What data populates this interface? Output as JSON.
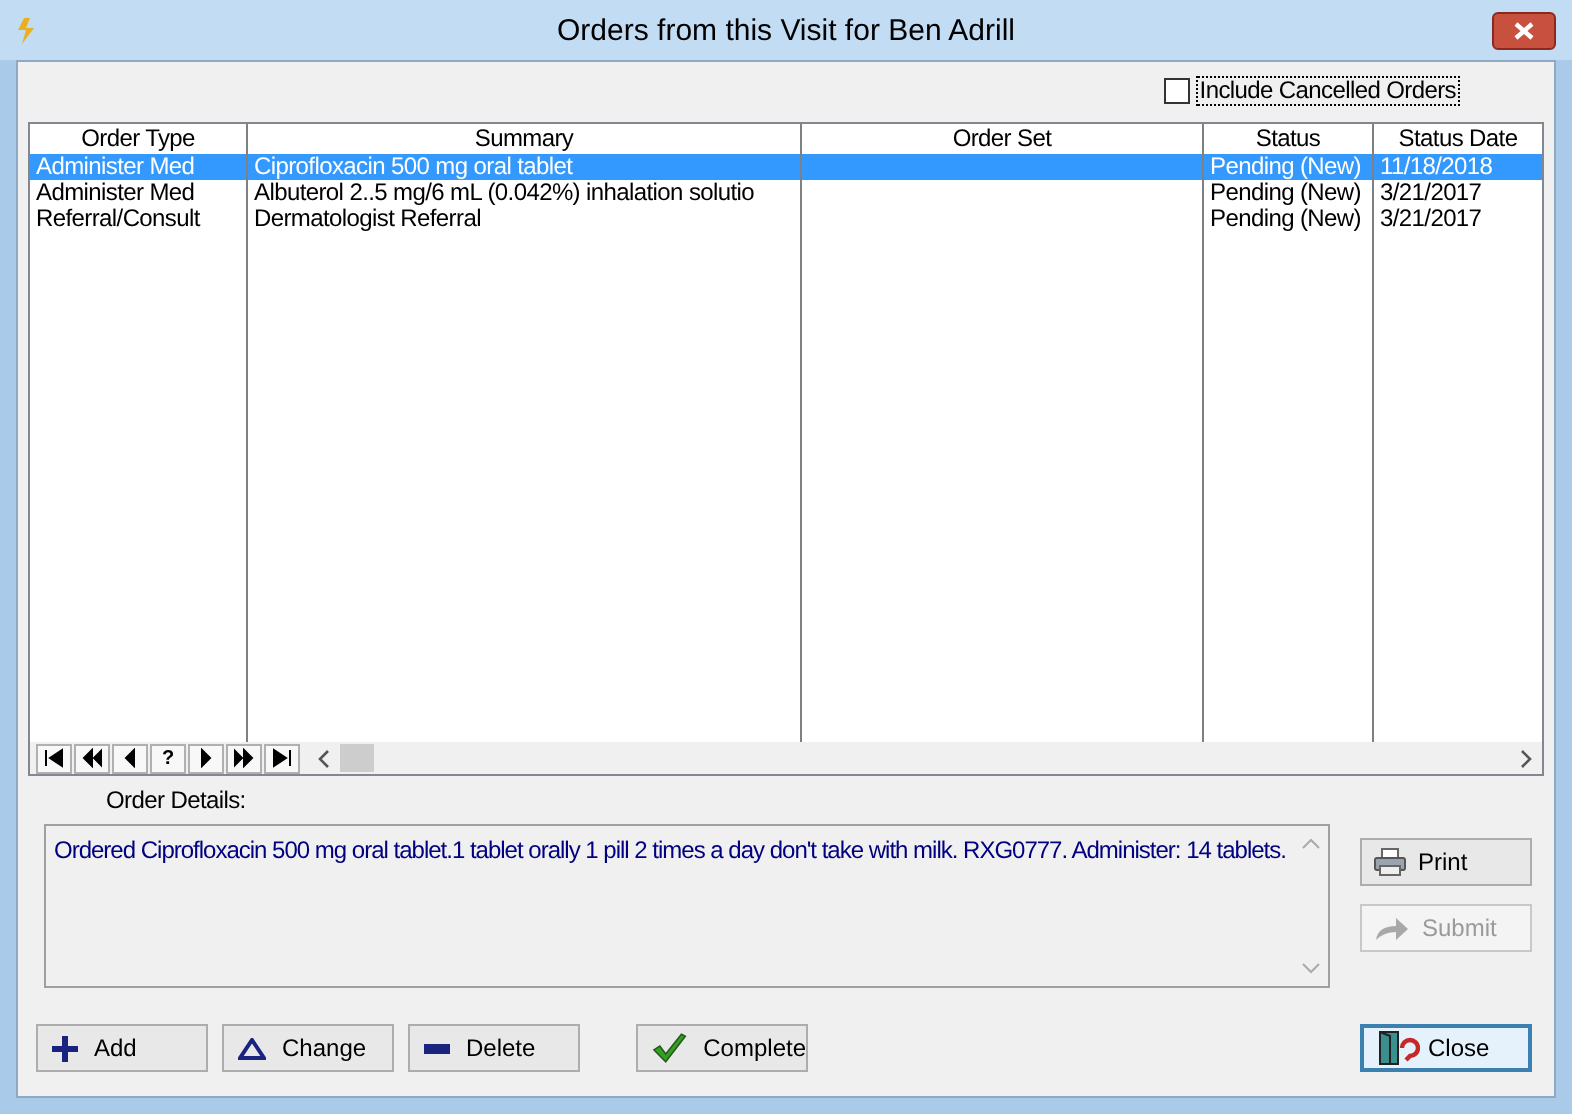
{
  "window": {
    "title": "Orders from this Visit for Ben Adrill"
  },
  "include_cancelled": {
    "label": "Include Cancelled Orders",
    "checked": false
  },
  "table": {
    "columns": [
      "Order Type",
      "Summary",
      "Order Set",
      "Status",
      "Status Date"
    ],
    "rows": [
      {
        "cells": [
          "Administer Med",
          "Ciprofloxacin 500 mg oral tablet",
          "",
          "Pending (New)",
          "11/18/2018"
        ],
        "selected": true
      },
      {
        "cells": [
          "Administer Med",
          "Albuterol 2..5 mg/6 mL (0.042%) inhalation solutio",
          "",
          "Pending (New)",
          "3/21/2017"
        ],
        "selected": false
      },
      {
        "cells": [
          "Referral/Consult",
          "Dermatologist Referral",
          "",
          "Pending (New)",
          "3/21/2017"
        ],
        "selected": false
      }
    ]
  },
  "navigator": [
    {
      "kind": "first"
    },
    {
      "kind": "prev-page"
    },
    {
      "kind": "prev"
    },
    {
      "kind": "help",
      "label": "?"
    },
    {
      "kind": "next"
    },
    {
      "kind": "next-page"
    },
    {
      "kind": "last"
    }
  ],
  "order_details": {
    "label": "Order Details:",
    "value": "Ordered Ciprofloxacin 500 mg oral tablet.1 tablet orally 1 pill 2 times a day don't take with milk.  RXG0777. Administer: 14 tablets."
  },
  "side_buttons": [
    {
      "label": "Print",
      "kind": "print",
      "disabled": false
    },
    {
      "label": "Submit",
      "kind": "submit",
      "disabled": true
    }
  ],
  "bottom_buttons": [
    {
      "label": "Add",
      "kind": "add"
    },
    {
      "label": "Change",
      "kind": "change"
    },
    {
      "label": "Delete",
      "kind": "delete"
    },
    {
      "label": "Complete",
      "kind": "complete"
    }
  ],
  "close_button": {
    "label": "Close",
    "focused": true
  }
}
